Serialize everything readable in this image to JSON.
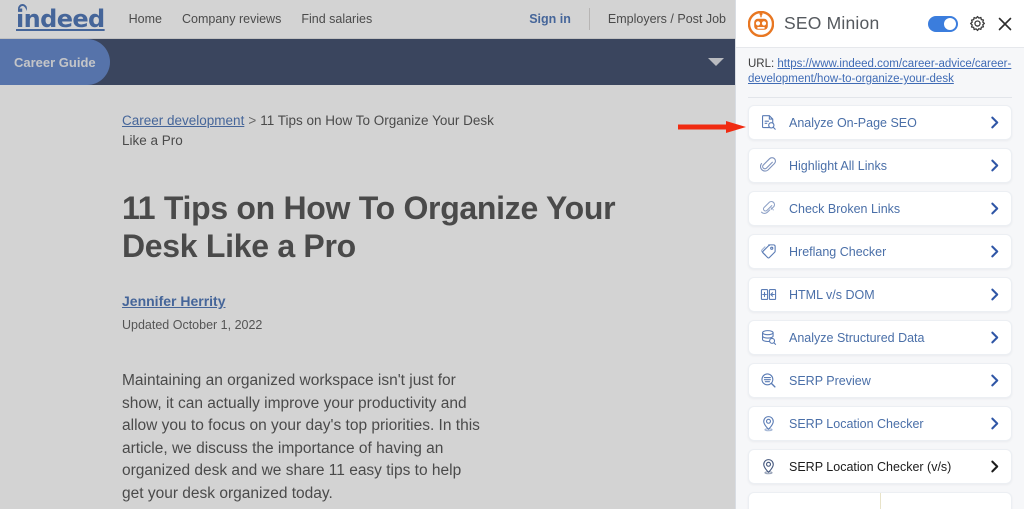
{
  "webpage": {
    "brand": "indeed",
    "nav": [
      {
        "label": "Home"
      },
      {
        "label": "Company reviews"
      },
      {
        "label": "Find salaries"
      }
    ],
    "sign_in": "Sign in",
    "employers": "Employers / Post Job",
    "guide_bar": {
      "label": "Career Guide",
      "caret_icon": "chevron-down-icon"
    },
    "breadcrumb": {
      "parent": "Career development",
      "separator": ">",
      "current": "11 Tips on How To Organize Your Desk Like a Pro"
    },
    "article": {
      "title": "11 Tips on How To Organize Your Desk Like a Pro",
      "author": "Jennifer Herrity",
      "updated": "Updated October 1, 2022",
      "lede": "Maintaining an organized workspace isn't just for show, it can actually improve your productivity and allow you to focus on your day's top priorities. In this article, we discuss the importance of having an organized desk and we share 11 easy tips to help get your desk organized today."
    }
  },
  "annotation": {
    "arrow_icon": "red-right-arrow-icon",
    "arrow_color": "#f02b11",
    "points_at": "Analyze On-Page SEO"
  },
  "panel": {
    "logo_icon": "seo-minion-robot-icon",
    "logo_color": "#e87722",
    "title": "SEO Minion",
    "toggle": {
      "name": "enable-toggle",
      "state": "on",
      "color": "#3b7ddd"
    },
    "settings_icon": "gear-icon",
    "close_icon": "close-icon",
    "url_label": "URL:",
    "url": "https://www.indeed.com/career-advice/career-development/how-to-organize-your-desk",
    "link_color": "#3f6bb5",
    "item_text_color": "#4a6fa8",
    "items": [
      {
        "label": "Analyze On-Page SEO",
        "icon": "document-search-icon",
        "chevron": "chevron-right-icon",
        "highlighted": false
      },
      {
        "label": "Highlight All Links",
        "icon": "paperclip-icon",
        "chevron": "chevron-right-icon",
        "highlighted": false
      },
      {
        "label": "Check Broken Links",
        "icon": "broken-paperclip-icon",
        "chevron": "chevron-right-icon",
        "highlighted": false
      },
      {
        "label": "Hreflang Checker",
        "icon": "tag-icon",
        "chevron": "chevron-right-icon",
        "highlighted": false
      },
      {
        "label": "HTML v/s DOM",
        "icon": "split-panel-icon",
        "chevron": "chevron-right-icon",
        "highlighted": false
      },
      {
        "label": "Analyze Structured Data",
        "icon": "database-search-icon",
        "chevron": "chevron-right-icon",
        "highlighted": false
      },
      {
        "label": "SERP Preview",
        "icon": "serp-search-icon",
        "chevron": "chevron-right-icon",
        "highlighted": false
      },
      {
        "label": "SERP Location Checker",
        "icon": "location-pin-icon",
        "chevron": "chevron-right-icon",
        "highlighted": false
      },
      {
        "label": "SERP Location Checker (v/s)",
        "icon": "location-pin-icon",
        "chevron": "chevron-right-icon",
        "highlighted": true
      }
    ]
  }
}
